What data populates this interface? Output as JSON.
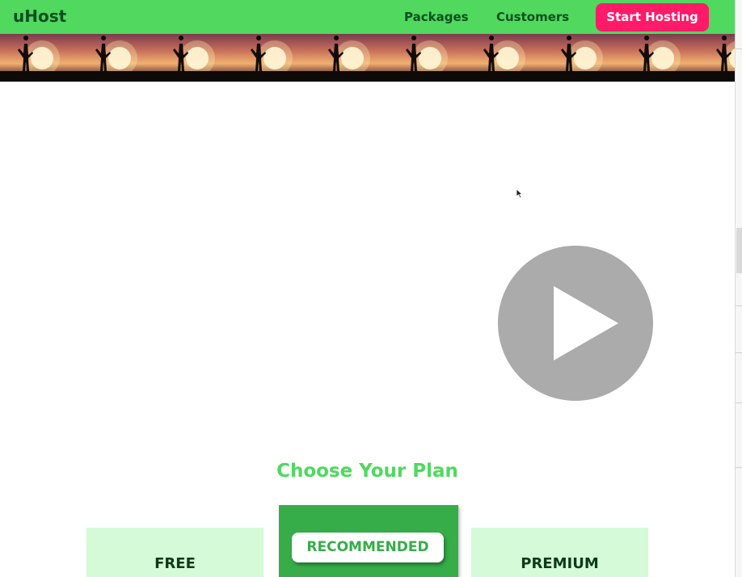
{
  "header": {
    "brand": "uHost",
    "nav": [
      {
        "label": "Packages"
      },
      {
        "label": "Customers"
      }
    ],
    "cta_label": "Start Hosting",
    "colors": {
      "bar": "#50d85f",
      "text": "#0e4f1f",
      "cta": "#ff1b68"
    }
  },
  "hero": {
    "tile_count": 10,
    "description_icon": "silhouette-sunset-tile"
  },
  "video": {
    "play_icon": "play-icon",
    "control_color": "#ababab"
  },
  "plans": {
    "title": "Choose Your Plan",
    "items": [
      {
        "name": "FREE"
      },
      {
        "badge": "RECOMMENDED"
      },
      {
        "name": "PREMIUM"
      }
    ],
    "colors": {
      "card": "#d5fad8",
      "featured": "#36ad49"
    }
  }
}
